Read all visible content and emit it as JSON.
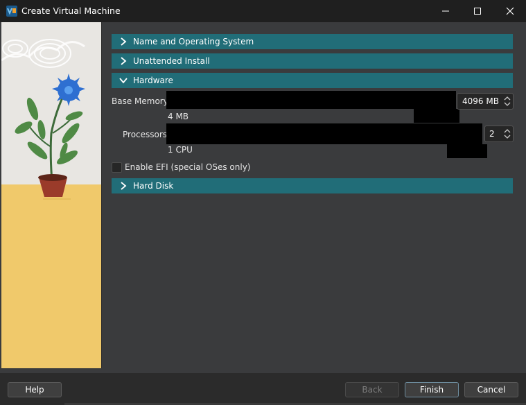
{
  "window": {
    "title": "Create Virtual Machine",
    "controls": {
      "minimize": "minimize-icon",
      "maximize": "maximize-icon",
      "close": "close-icon"
    }
  },
  "sections": {
    "name_os": {
      "label": "Name and Operating System",
      "expanded": false
    },
    "unattended": {
      "label": "Unattended Install",
      "expanded": false
    },
    "hardware": {
      "label": "Hardware",
      "expanded": true
    },
    "hard_disk": {
      "label": "Hard Disk",
      "expanded": false
    }
  },
  "hardware": {
    "base_memory_label": "Base Memory:",
    "base_memory_value": "4096 MB",
    "base_memory_min": "4 MB",
    "processors_label": "Processors:",
    "processors_value": "2",
    "processors_min": "1 CPU",
    "efi_label": "Enable EFI (special OSes only)",
    "efi_checked": false
  },
  "buttons": {
    "help": "Help",
    "back": "Back",
    "finish": "Finish",
    "cancel": "Cancel"
  },
  "colors": {
    "section_header": "#216d78",
    "background": "#3a3b3d",
    "titlebar": "#1f1f1f"
  }
}
